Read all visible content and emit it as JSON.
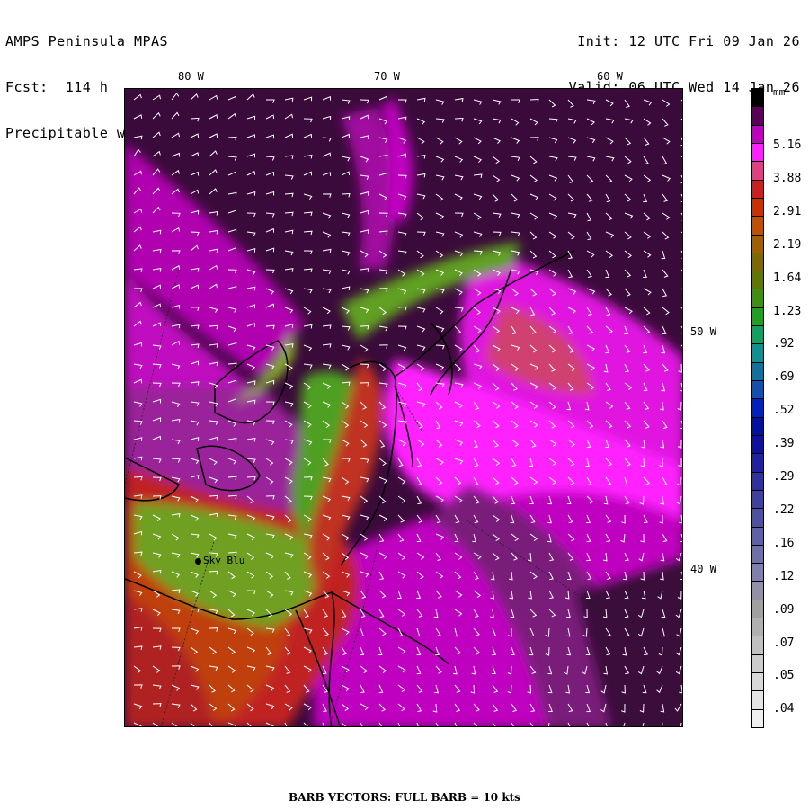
{
  "header": {
    "left_line1": "AMPS Peninsula MPAS",
    "left_line2": "Fcst:  114 h",
    "left_line3": "Precipitable water vapor",
    "right_line1": "Init: 12 UTC Fri 09 Jan 26",
    "right_line2": "Valid: 06 UTC Wed 14 Jan 26"
  },
  "axes": {
    "top": [
      "80 W",
      "70 W",
      "60 W"
    ],
    "right": [
      "50 W",
      "40 W"
    ]
  },
  "colorbar": {
    "units": "mm",
    "labels": [
      "5.16",
      "3.88",
      "2.91",
      "2.19",
      "1.64",
      "1.23",
      ".92",
      ".69",
      ".52",
      ".39",
      ".29",
      ".22",
      ".16",
      ".12",
      ".09",
      ".07",
      ".05",
      ".04"
    ],
    "colors": [
      "#000000",
      "#5a005a",
      "#c000c0",
      "#ff20ff",
      "#e04080",
      "#cc2020",
      "#c83000",
      "#c05000",
      "#a06000",
      "#806800",
      "#607800",
      "#409010",
      "#20a020",
      "#10a060",
      "#109090",
      "#1070a0",
      "#1050b0",
      "#0020c0",
      "#0010a0",
      "#1010a0",
      "#2020a0",
      "#3030a0",
      "#4040a0",
      "#5050a0",
      "#6060a8",
      "#7070a8",
      "#8080b0",
      "#9090a8",
      "#a0a0a0",
      "#b0b0b0",
      "#c0c0c0",
      "#cccccc",
      "#d8d8d8",
      "#e4e4e4",
      "#f0f0f0"
    ]
  },
  "station": {
    "name": "Sky Blu"
  },
  "footer": "BARB VECTORS:  FULL BARB = 10 kts",
  "palette": {
    "dark_purple": "#3a0a3a",
    "deep_purple": "#5a105a",
    "purple": "#8a208a",
    "magenta": "#c000c0",
    "bright_magenta": "#ff20ff",
    "pink_red": "#d04070",
    "red": "#c02020",
    "orange_red": "#c04010",
    "olive": "#808020",
    "green": "#40a020"
  }
}
